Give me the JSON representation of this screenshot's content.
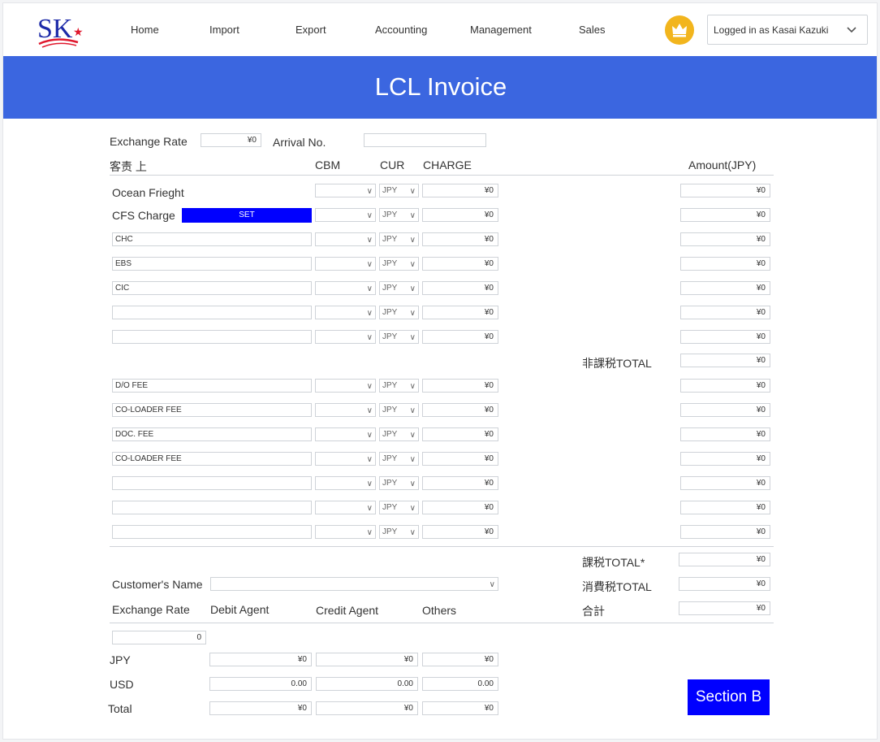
{
  "logo": {
    "text": "SK",
    "star": "★"
  },
  "nav": [
    "Home",
    "Import",
    "Export",
    "Accounting",
    "Management",
    "Sales"
  ],
  "user": {
    "label": "Logged in as Kasai Kazuki",
    "badge_icon": "crown-icon"
  },
  "banner": {
    "title": "LCL Invoice"
  },
  "top": {
    "exchange_rate_label": "Exchange Rate",
    "exchange_rate_value": "¥0",
    "arrival_label": "Arrival No.",
    "arrival_value": ""
  },
  "headers": {
    "customer": "客责 上",
    "cbm": "CBM",
    "cur": "CUR",
    "charge": "CHARGE",
    "amount": "Amount(JPY)"
  },
  "section1": {
    "ocean_label": "Ocean Frieght",
    "cfs_label": "CFS Charge",
    "set_button": "SET",
    "rows": [
      {
        "name": "",
        "cur": "JPY",
        "charge": "¥0",
        "amount": "¥0"
      },
      {
        "name": "",
        "cur": "JPY",
        "charge": "¥0",
        "amount": "¥0"
      },
      {
        "name": "CHC",
        "cur": "JPY",
        "charge": "¥0",
        "amount": "¥0"
      },
      {
        "name": "EBS",
        "cur": "JPY",
        "charge": "¥0",
        "amount": "¥0"
      },
      {
        "name": "CIC",
        "cur": "JPY",
        "charge": "¥0",
        "amount": "¥0"
      },
      {
        "name": "",
        "cur": "JPY",
        "charge": "¥0",
        "amount": "¥0"
      },
      {
        "name": "",
        "cur": "JPY",
        "charge": "¥0",
        "amount": "¥0"
      }
    ],
    "total_label": "非課税TOTAL",
    "total_value": "¥0"
  },
  "section2": {
    "rows": [
      {
        "name": "D/O FEE",
        "cur": "JPY",
        "charge": "¥0",
        "amount": "¥0"
      },
      {
        "name": "CO-LOADER FEE",
        "cur": "JPY",
        "charge": "¥0",
        "amount": "¥0"
      },
      {
        "name": "DOC. FEE",
        "cur": "JPY",
        "charge": "¥0",
        "amount": "¥0"
      },
      {
        "name": "CO-LOADER FEE",
        "cur": "JPY",
        "charge": "¥0",
        "amount": "¥0"
      },
      {
        "name": "",
        "cur": "JPY",
        "charge": "¥0",
        "amount": "¥0"
      },
      {
        "name": "",
        "cur": "JPY",
        "charge": "¥0",
        "amount": "¥0"
      },
      {
        "name": "",
        "cur": "JPY",
        "charge": "¥0",
        "amount": "¥0"
      }
    ]
  },
  "totals": {
    "taxable_label": "課税TOTAL*",
    "taxable_value": "¥0",
    "consumption_label": "消費税TOTAL",
    "consumption_value": "¥0",
    "grand_label": "合計",
    "grand_value": "¥0"
  },
  "customer": {
    "label": "Customer's Name",
    "value": ""
  },
  "bottom": {
    "exchange_rate_label": "Exchange Rate",
    "exchange_rate_value": "0",
    "debit_label": "Debit Agent",
    "credit_label": "Credit Agent",
    "others_label": "Others",
    "rows": [
      {
        "label": "JPY",
        "debit": "¥0",
        "credit": "¥0",
        "others": "¥0"
      },
      {
        "label": "USD",
        "debit": "0.00",
        "credit": "0.00",
        "others": "0.00"
      },
      {
        "label": "Total",
        "debit": "¥0",
        "credit": "¥0",
        "others": "¥0"
      }
    ]
  },
  "section_b_button": "Section B",
  "colors": {
    "banner": "#3b66e0",
    "button": "#0000ff",
    "crown": "#f2b51d",
    "logo_text": "#1d2aa8",
    "logo_star": "#e0182d"
  }
}
